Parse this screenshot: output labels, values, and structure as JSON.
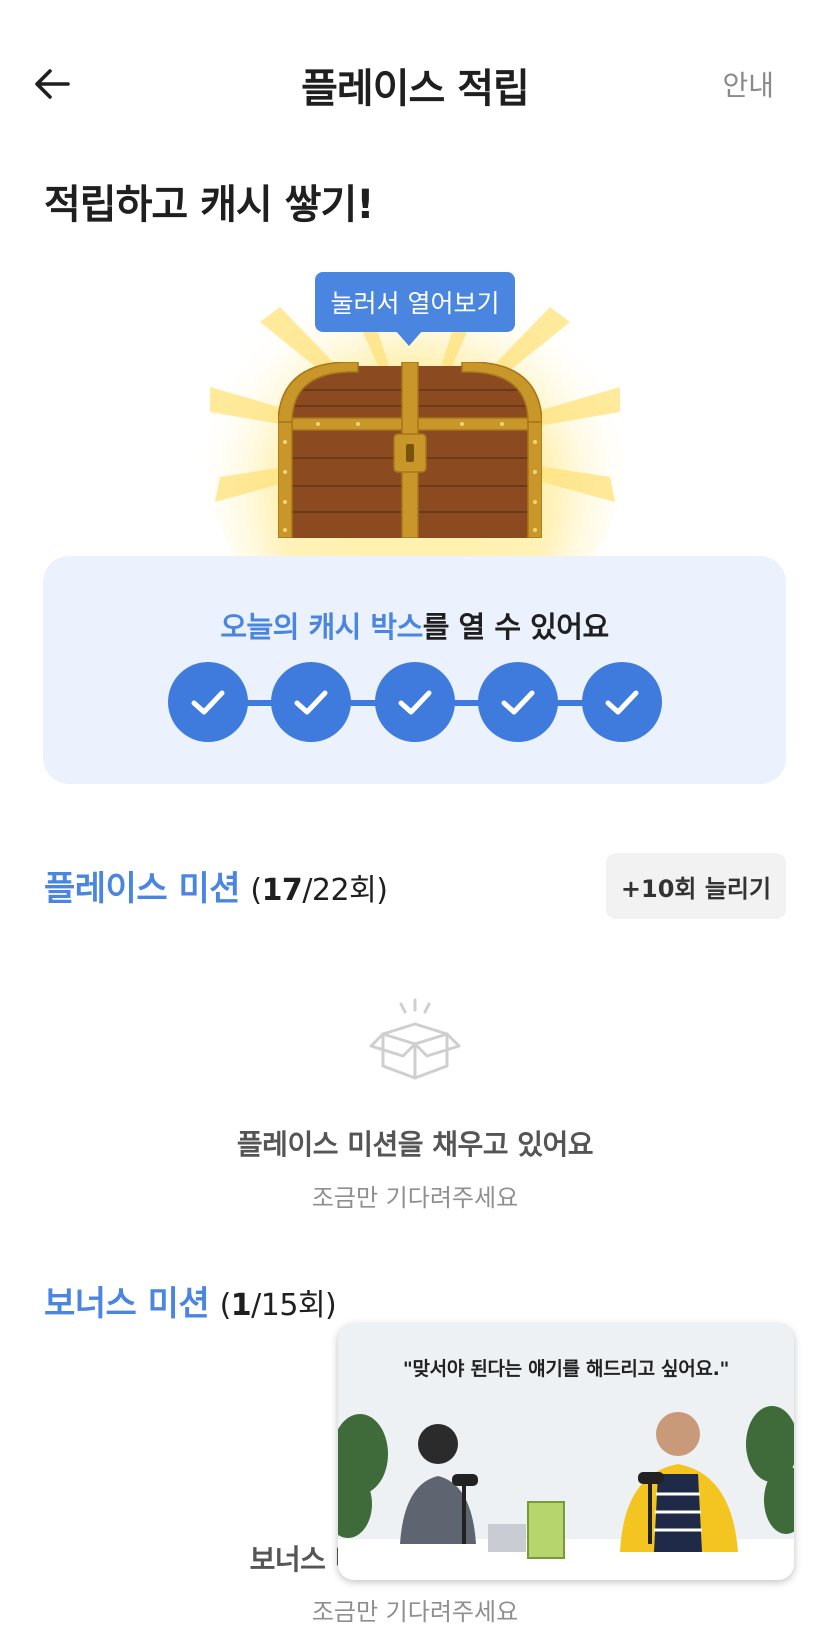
{
  "header": {
    "title": "플레이스 적립",
    "guide_label": "안내"
  },
  "main_heading": "적립하고 캐시 쌓기!",
  "chest": {
    "tooltip": "눌러서 열어보기"
  },
  "cash_box": {
    "highlight": "오늘의 캐시 박스",
    "rest": "를 열 수 있어요",
    "steps_total": 5,
    "steps_done": 5
  },
  "place_mission": {
    "name": "플레이스 미션",
    "open": "(",
    "done": "17",
    "total": "/22회)",
    "add_button": "+10회 늘리기",
    "empty_title": "플레이스 미션을 채우고 있어요",
    "empty_sub": "조금만 기다려주세요"
  },
  "bonus_mission": {
    "name": "보너스 미션",
    "open": "(",
    "done": "1",
    "total": "/15회)",
    "empty_title": "보너스 미션을 채우고 있어요",
    "empty_sub": "조금만 기다려주세요"
  },
  "video": {
    "caption": "\"맞서야 된다는 얘기를 해드리고 싶어요.\""
  },
  "colors": {
    "accent": "#4a86e0",
    "card_bg": "#ebf2fd",
    "chest_wood": "#8b4a1f",
    "chest_gold": "#c9962a"
  }
}
